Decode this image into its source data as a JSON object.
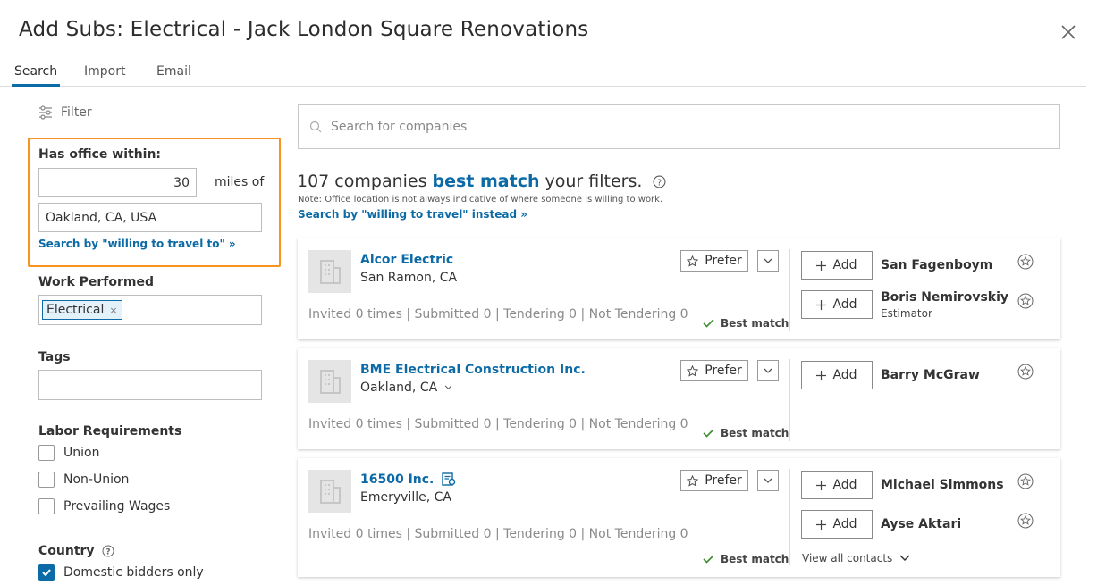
{
  "header": {
    "title": "Add Subs: Electrical - Jack London Square Renovations"
  },
  "tabs": [
    {
      "label": "Search"
    },
    {
      "label": "Import"
    },
    {
      "label": "Email"
    }
  ],
  "filter": {
    "heading": "Filter",
    "office_label": "Has office within:",
    "miles_value": "30",
    "miles_suffix": "miles of",
    "location_value": "Oakland, CA, USA",
    "travel_link": "Search by \"willing to travel to\" »",
    "work_label": "Work Performed",
    "work_chip": "Electrical",
    "tags_label": "Tags",
    "labor_label": "Labor Requirements",
    "labor_options": [
      "Union",
      "Non-Union",
      "Prevailing Wages"
    ],
    "country_label": "Country",
    "domestic_label": "Domestic bidders only"
  },
  "search": {
    "placeholder": "Search for companies"
  },
  "results": {
    "count_text": "107 companies",
    "best_match": "best match",
    "suffix": "your filters.",
    "note": "Note: Office location is not always indicative of where someone is willing to work.",
    "travel_link": "Search by \"willing to travel\" instead »"
  },
  "companies": [
    {
      "name": "Alcor Electric",
      "location": "San Ramon, CA",
      "stats": "Invited 0 times | Submitted 0 | Tendering 0 | Not Tendering 0",
      "prefer": "Prefer",
      "best_match": "Best match",
      "add_label": "Add",
      "contacts": [
        {
          "name": "San Fagenboym",
          "role": ""
        },
        {
          "name": "Boris Nemirovskiy",
          "role": "Estimator"
        }
      ]
    },
    {
      "name": "BME Electrical Construction Inc.",
      "location": "Oakland, CA",
      "stats": "Invited 0 times | Submitted 0 | Tendering 0 | Not Tendering 0",
      "prefer": "Prefer",
      "best_match": "Best match",
      "add_label": "Add",
      "contacts": [
        {
          "name": "Barry McGraw",
          "role": ""
        }
      ]
    },
    {
      "name": "16500 Inc.",
      "location": "Emeryville, CA",
      "stats": "Invited 0 times | Submitted 0 | Tendering 0 | Not Tendering 0",
      "prefer": "Prefer",
      "best_match": "Best match",
      "add_label": "Add",
      "contacts": [
        {
          "name": "Michael Simmons",
          "role": ""
        },
        {
          "name": "Ayse Aktari",
          "role": ""
        }
      ],
      "view_all": "View all contacts"
    }
  ],
  "colors": {
    "accent": "#0c6aa6",
    "highlight_border": "#f7931e",
    "success": "#3d8b2f"
  }
}
